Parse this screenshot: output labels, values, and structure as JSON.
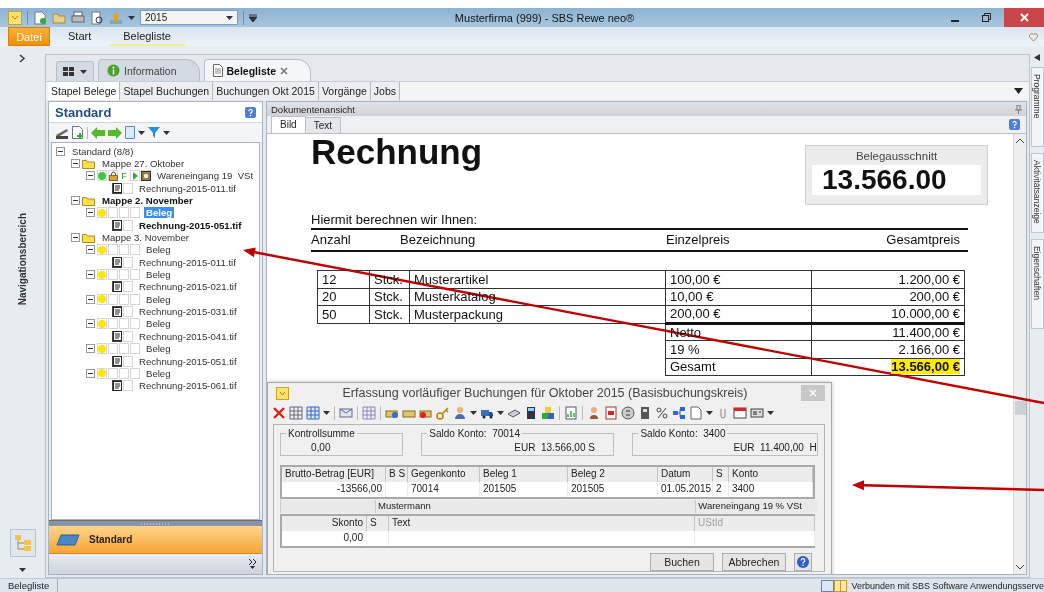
{
  "window": {
    "title": "Musterfirma (999) - SBS Rewe neo®",
    "year_combo": "2015"
  },
  "ribbon_tabs": [
    {
      "label": "Datei",
      "kind": "file",
      "selected": false
    },
    {
      "label": "Start",
      "kind": "tab",
      "selected": false
    },
    {
      "label": "Belegliste",
      "kind": "tab",
      "selected": true
    }
  ],
  "nav": {
    "label": "Navigationsbereich"
  },
  "doc_tabs": [
    {
      "label": "Information",
      "selected": false,
      "closable": false
    },
    {
      "label": "Belegliste",
      "selected": true,
      "closable": true
    }
  ],
  "sub_tabs": [
    {
      "label": "Stapel Belege",
      "selected": true
    },
    {
      "label": "Stapel Buchungen",
      "selected": false
    },
    {
      "label": "Buchungen Okt 2015",
      "selected": false
    },
    {
      "label": "Vorgänge",
      "selected": false
    },
    {
      "label": "Jobs",
      "selected": false
    }
  ],
  "tree_panel": {
    "title": "Standard",
    "footer": "Standard",
    "tree": [
      {
        "label": "Standard (8/8)",
        "kind": "root",
        "bold": false,
        "selected": false,
        "children": [
          {
            "label": "Mappe 27. Oktober",
            "kind": "folder",
            "bold": false,
            "selected": false,
            "children": [
              {
                "label": "Wareneingang 19  VSt",
                "kind": "beleg",
                "color": "#3ec83e",
                "locked": true,
                "status_letter": "F",
                "bold": false,
                "selected": false,
                "children": [
                  {
                    "label": "Rechnung-2015-011.tif",
                    "kind": "file",
                    "bold": false,
                    "selected": false
                  }
                ]
              }
            ]
          },
          {
            "label": "Mappe 2. November",
            "kind": "folder",
            "bold": true,
            "selected": false,
            "children": [
              {
                "label": "Beleg",
                "kind": "beleg",
                "color": "#ffe600",
                "locked": false,
                "bold": true,
                "selected": true,
                "children": [
                  {
                    "label": "Rechnung-2015-051.tif",
                    "kind": "file",
                    "bold": true,
                    "selected": false
                  }
                ]
              }
            ]
          },
          {
            "label": "Mappe 3. November",
            "kind": "folder",
            "bold": false,
            "selected": false,
            "children": [
              {
                "label": "Beleg",
                "kind": "beleg",
                "color": "#ffe600",
                "locked": false,
                "bold": false,
                "selected": false,
                "children": [
                  {
                    "label": "Rechnung-2015-011.tif",
                    "kind": "file",
                    "bold": false,
                    "selected": false
                  }
                ]
              },
              {
                "label": "Beleg",
                "kind": "beleg",
                "color": "#ffe600",
                "locked": false,
                "bold": false,
                "selected": false,
                "children": [
                  {
                    "label": "Rechnung-2015-021.tif",
                    "kind": "file",
                    "bold": false,
                    "selected": false
                  }
                ]
              },
              {
                "label": "Beleg",
                "kind": "beleg",
                "color": "#ffe600",
                "locked": false,
                "bold": false,
                "selected": false,
                "children": [
                  {
                    "label": "Rechnung-2015-031.tif",
                    "kind": "file",
                    "bold": false,
                    "selected": false
                  }
                ]
              },
              {
                "label": "Beleg",
                "kind": "beleg",
                "color": "#ffe600",
                "locked": false,
                "bold": false,
                "selected": false,
                "children": [
                  {
                    "label": "Rechnung-2015-041.tif",
                    "kind": "file",
                    "bold": false,
                    "selected": false
                  }
                ]
              },
              {
                "label": "Beleg",
                "kind": "beleg",
                "color": "#ffe600",
                "locked": false,
                "bold": false,
                "selected": false,
                "children": [
                  {
                    "label": "Rechnung-2015-051.tif",
                    "kind": "file",
                    "bold": false,
                    "selected": false
                  }
                ]
              },
              {
                "label": "Beleg",
                "kind": "beleg",
                "color": "#ffe600",
                "locked": false,
                "bold": false,
                "selected": false,
                "children": [
                  {
                    "label": "Rechnung-2015-061.tif",
                    "kind": "file",
                    "bold": false,
                    "selected": false
                  }
                ]
              }
            ]
          }
        ]
      }
    ]
  },
  "document_view": {
    "title": "Dokumentenansicht",
    "tabs": [
      {
        "label": "Bild",
        "selected": true
      },
      {
        "label": "Text",
        "selected": false
      }
    ],
    "invoice": {
      "title": "Rechnung",
      "excerpt_label": "Belegausschnitt",
      "excerpt_value": "13.566.00",
      "intro": "Hiermit berechnen wir Ihnen:",
      "columns": [
        "Anzahl",
        "Bezeichnung",
        "Einzelpreis",
        "Gesamtpreis"
      ],
      "items": [
        {
          "qty": "12",
          "unit": "Stck.",
          "name": "Musterartikel",
          "price": "100,00 €",
          "total": "1.200,00 €"
        },
        {
          "qty": "20",
          "unit": "Stck.",
          "name": "Musterkatalog",
          "price": "10,00 €",
          "total": "200,00 €"
        },
        {
          "qty": "50",
          "unit": "Stck.",
          "name": "Musterpackung",
          "price": "200,00 €",
          "total": "10.000,00 €"
        }
      ],
      "totals": [
        {
          "label": "Netto",
          "value": "11.400,00 €",
          "highlighted": false
        },
        {
          "label": "19 %",
          "value": "2.166,00 €",
          "highlighted": false
        },
        {
          "label": "Gesamt",
          "value": "13.566,00 €",
          "highlighted": true
        }
      ]
    }
  },
  "dialog": {
    "title": "Erfassung vorläufiger Buchungen für Oktober 2015 (Basisbuchungskreis)",
    "summaries": [
      {
        "label": "Kontrollsumme",
        "value": "0,00"
      },
      {
        "label": "Saldo Konto:  70014",
        "value": "EUR  13.566,00 S"
      },
      {
        "label": "Saldo Konto:  3400",
        "value": "EUR  11.400,00  H"
      }
    ],
    "booking_grid": {
      "columns": [
        {
          "label": "Brutto-Betrag [EUR]",
          "value": "-13566,00"
        },
        {
          "label": "B S"
        },
        {
          "label": "Gegenkonto",
          "value": "70014"
        },
        {
          "label": "Beleg 1",
          "value": "201505"
        },
        {
          "label": "Beleg 2",
          "value": "201505"
        },
        {
          "label": "Datum",
          "value": "01.05.2015"
        },
        {
          "label": "S",
          "value": "2"
        },
        {
          "label": "Konto",
          "value": "3400"
        }
      ]
    },
    "info": [
      "Mustermann",
      "Wareneingang 19 % VSt"
    ],
    "discount_grid": {
      "columns": [
        {
          "label": "Skonto",
          "disabled": false,
          "value": "0,00"
        },
        {
          "label": "S",
          "disabled": false
        },
        {
          "label": "Text",
          "disabled": false
        },
        {
          "label": "UStId",
          "disabled": true
        }
      ]
    },
    "buttons": [
      "Buchen",
      "Abbrechen"
    ]
  },
  "side_tabs": [
    "Programme",
    "Aktivitätsanzeige",
    "Eigenschaften"
  ],
  "status_bar": {
    "left": "Belegliste",
    "right": "Verbunden mit SBS Software Anwendungsserve"
  }
}
